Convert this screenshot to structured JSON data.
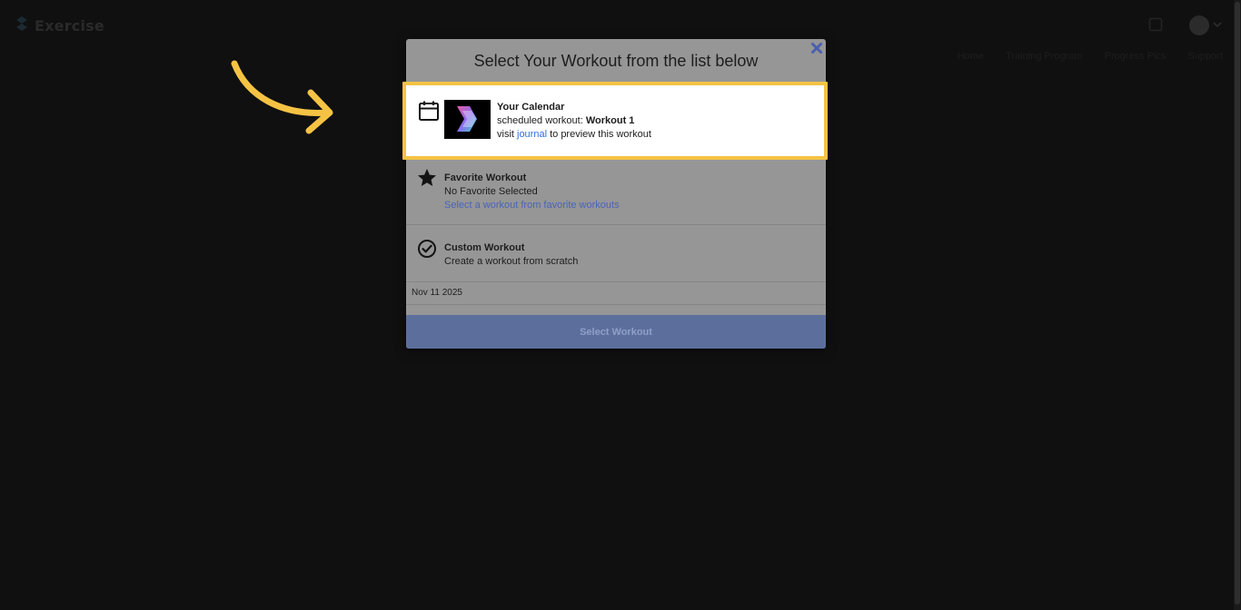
{
  "app": {
    "name": "Exercise"
  },
  "nav": {
    "items": [
      "Home",
      "Training Program",
      "Progress Pics",
      "Support"
    ]
  },
  "modal": {
    "title": "Select Your Workout from the list below",
    "close_icon": "close-icon",
    "options": [
      {
        "icon": "calendar-icon",
        "title": "Your Calendar",
        "line1_prefix": "scheduled workout: ",
        "line1_value": "Workout 1",
        "line2_prefix": "visit ",
        "line2_link": "journal",
        "line2_suffix": " to preview this workout",
        "highlighted": true
      },
      {
        "icon": "star-icon",
        "title": "Favorite Workout",
        "line1": "No Favorite Selected",
        "line2_link": "Select a workout from favorite workouts"
      },
      {
        "icon": "check-circle-icon",
        "title": "Custom Workout",
        "line1": "Create a workout from scratch"
      }
    ],
    "date": "Nov 11 2025",
    "select_button": "Select Workout"
  },
  "colors": {
    "highlight_border": "#f5c344",
    "arrow": "#f5c344",
    "button": "#5c6f9c",
    "link": "#4a63b8",
    "overlay_bg": "#101010"
  }
}
